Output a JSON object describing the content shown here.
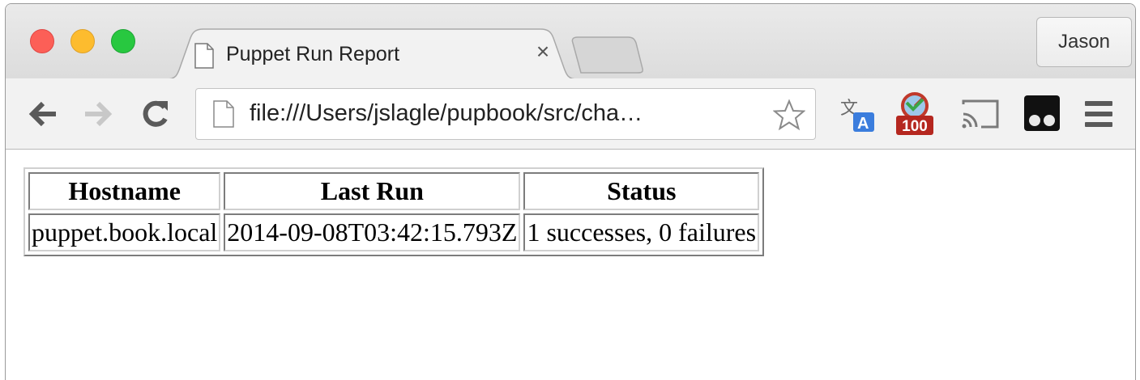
{
  "tab": {
    "title": "Puppet Run Report",
    "close_glyph": "×"
  },
  "profile": {
    "name": "Jason"
  },
  "omnibox": {
    "url": "file:///Users/jslagle/pupbook/src/cha…"
  },
  "extensions": {
    "badge_count": "100"
  },
  "colors": {
    "close": "#fc5f57",
    "minimize": "#fdbc2e",
    "zoom": "#28c840"
  },
  "report": {
    "headers": [
      "Hostname",
      "Last Run",
      "Status"
    ],
    "rows": [
      [
        "puppet.book.local",
        "2014-09-08T03:42:15.793Z",
        "1 successes, 0 failures"
      ]
    ]
  }
}
